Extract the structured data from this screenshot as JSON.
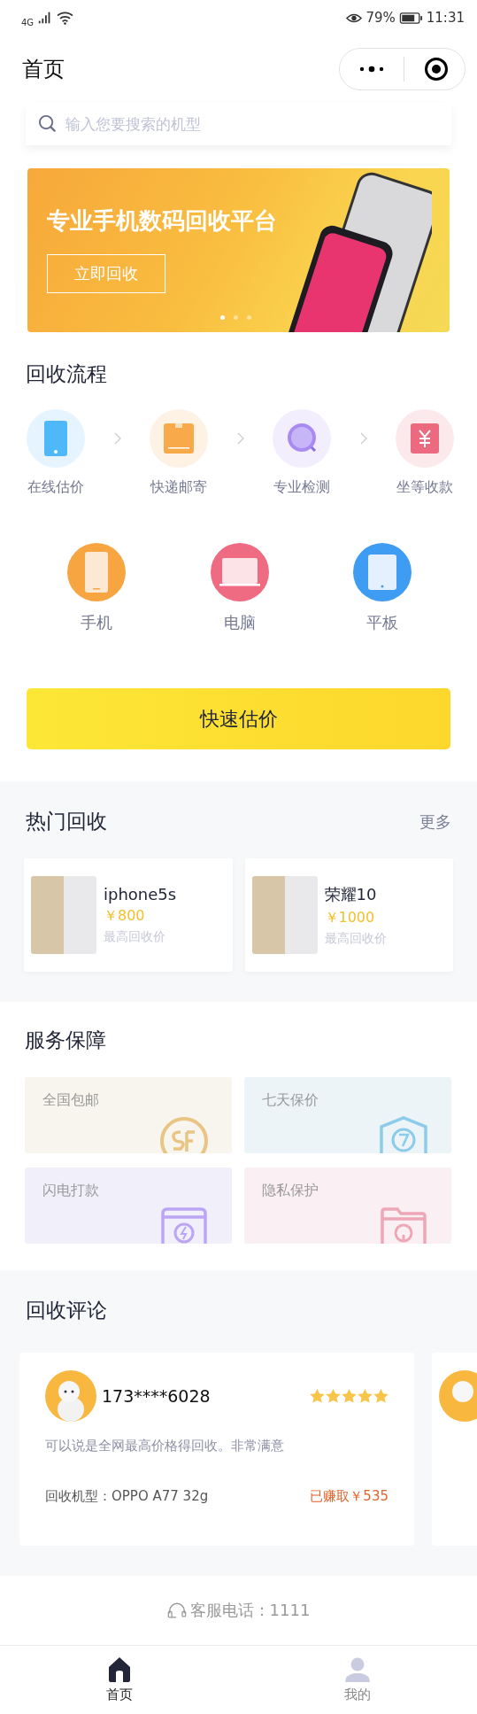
{
  "status_bar": {
    "network": "4G",
    "battery": "79%",
    "time": "11:31"
  },
  "nav": {
    "title": "首页"
  },
  "search": {
    "placeholder": "输入您要搜索的机型"
  },
  "banner": {
    "headline": "专业手机数码回收平台",
    "button": "立即回收",
    "dots": [
      {
        "selected": true
      },
      {
        "selected": false
      },
      {
        "selected": false
      }
    ]
  },
  "process": {
    "title": "回收流程",
    "steps": [
      {
        "label": "在线估价",
        "kind": "phone",
        "color": "#4fb8f8"
      },
      {
        "label": "快递邮寄",
        "kind": "box",
        "color": "#f8a94a"
      },
      {
        "label": "专业检测",
        "kind": "magnifier",
        "color": "#a98af0"
      },
      {
        "label": "坐等收款",
        "kind": "money",
        "color": "#ec6a80"
      }
    ]
  },
  "categories": [
    {
      "label": "手机",
      "kind": "phone",
      "color": "#f7a541"
    },
    {
      "label": "电脑",
      "kind": "laptop",
      "color": "#ef6b82"
    },
    {
      "label": "平板",
      "kind": "tablet",
      "color": "#3e9cf2"
    }
  ],
  "quick_button": "快速估价",
  "hot": {
    "title": "热门回收",
    "more": "更多",
    "items": [
      {
        "name": "iphone5s",
        "price": "￥800",
        "note": "最高回收价"
      },
      {
        "name": "荣耀10",
        "price": "￥1000",
        "note": "最高回收价"
      }
    ]
  },
  "service": {
    "title": "服务保障",
    "items": [
      {
        "label": "全国包邮",
        "kind": "sf",
        "color": "#e8c585"
      },
      {
        "label": "七天保价",
        "kind": "shield",
        "color": "#8ccbea"
      },
      {
        "label": "闪电打款",
        "kind": "wallet",
        "color": "#bba6f4"
      },
      {
        "label": "隐私保护",
        "kind": "folder",
        "color": "#eea7b6"
      }
    ]
  },
  "reviews": {
    "title": "回收评论",
    "items": [
      {
        "user": "173****6028",
        "stars": 5,
        "text": "可以说是全网最高价格得回收。非常满意",
        "model": "回收机型：OPPO A77 32g",
        "earned": "已赚取￥535"
      }
    ]
  },
  "hotline": "客服电话：1111",
  "tabs": [
    {
      "label": "首页",
      "kind": "home",
      "selected": true
    },
    {
      "label": "我的",
      "kind": "user",
      "selected": false
    }
  ]
}
